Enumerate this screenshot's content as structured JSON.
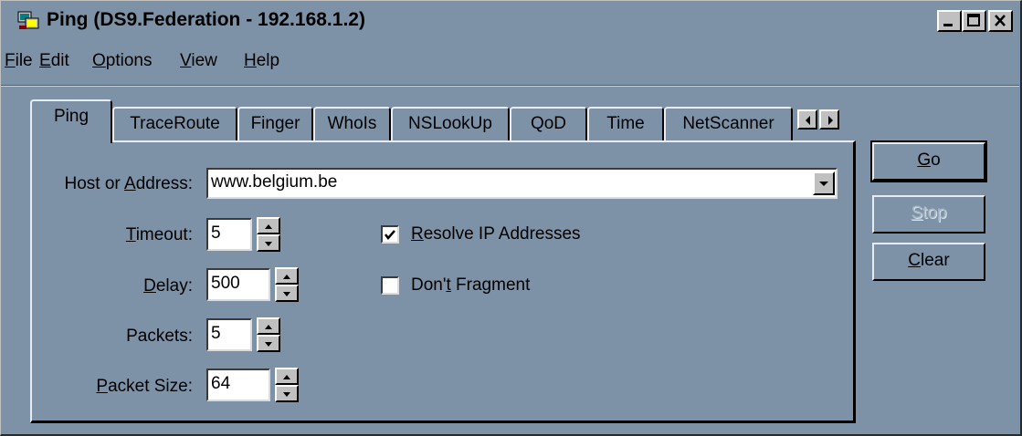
{
  "window": {
    "title": "Ping (DS9.Federation - 192.168.1.2)",
    "app_icon": "network-computer-icon"
  },
  "menu": [
    {
      "pre": "",
      "key": "F",
      "post": "ile"
    },
    {
      "pre": "",
      "key": "E",
      "post": "dit"
    },
    {
      "pre": "",
      "key": "O",
      "post": "ptions"
    },
    {
      "pre": "",
      "key": "V",
      "post": "iew"
    },
    {
      "pre": "",
      "key": "H",
      "post": "elp"
    }
  ],
  "tabs": [
    "Ping",
    "TraceRoute",
    "Finger",
    "WhoIs",
    "NSLookUp",
    "QoD",
    "Time",
    "NetScanner"
  ],
  "active_tab": "Ping",
  "form": {
    "host": {
      "pre": "Host or ",
      "key": "A",
      "post": "ddress:",
      "value": "www.belgium.be"
    },
    "timeout": {
      "pre": "",
      "key": "T",
      "post": "imeout:",
      "value": "5"
    },
    "delay": {
      "pre": "",
      "key": "D",
      "post": "elay:",
      "value": "500"
    },
    "packets": {
      "label": "Packets:",
      "value": "5"
    },
    "packet_size": {
      "pre": "",
      "key": "P",
      "post": "acket Size:",
      "value": "64"
    },
    "resolve": {
      "pre": "",
      "key": "R",
      "post": "esolve IP Addresses",
      "checked": true
    },
    "dont_fragment": {
      "pre": "Don'",
      "key": "t",
      "post": " Fragment",
      "checked": false
    }
  },
  "buttons": {
    "go": {
      "key": "G",
      "post": "o"
    },
    "stop": {
      "key": "S",
      "post": "top",
      "disabled": true
    },
    "clear": {
      "key": "C",
      "post": "lear"
    }
  },
  "colors": {
    "face": "#7d92a6",
    "disabled_text": "#a9b6c4"
  }
}
